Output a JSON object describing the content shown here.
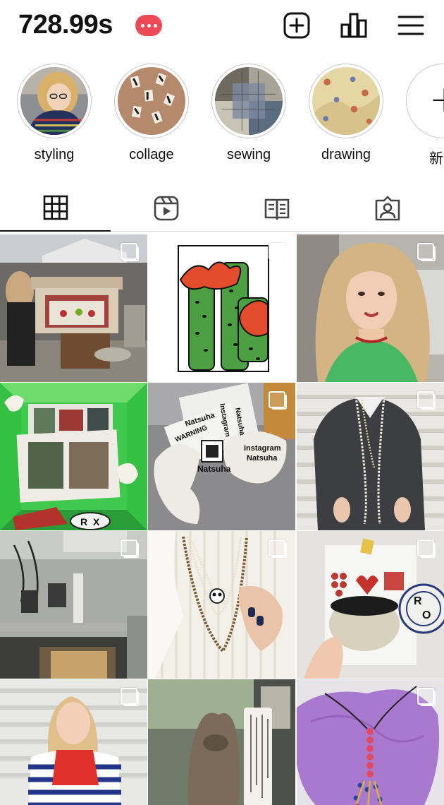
{
  "header": {
    "username": "728.99s",
    "badge": "more",
    "icons": [
      "new-post-icon",
      "insights-icon",
      "menu-icon"
    ]
  },
  "highlights": [
    {
      "label": "styling"
    },
    {
      "label": "collage"
    },
    {
      "label": "sewing"
    },
    {
      "label": "drawing"
    },
    {
      "label": "新規"
    }
  ],
  "tabs": [
    "grid-icon",
    "reels-icon",
    "guides-icon",
    "tagged-icon"
  ],
  "grid": {
    "posts": [
      {
        "subject": "miniature stage street market",
        "multi": true
      },
      {
        "subject": "cactus drawing",
        "multi": true
      },
      {
        "subject": "portrait green top",
        "multi": true
      },
      {
        "subject": "green box collage",
        "multi": false
      },
      {
        "subject": "Natsuha butterfly cutouts",
        "multi": true
      },
      {
        "subject": "pearl necklaces",
        "multi": true
      },
      {
        "subject": "building exterior",
        "multi": true
      },
      {
        "subject": "pearl panda necklace",
        "multi": true
      },
      {
        "subject": "ceramic bowl",
        "multi": true
      },
      {
        "subject": "striped sweater",
        "multi": true
      },
      {
        "subject": "tree sculpture sign",
        "multi": false
      },
      {
        "subject": "beaded tassel on purple",
        "multi": true
      }
    ],
    "cutout_texts": [
      "Natsuha",
      "Instagram",
      "Natsuha",
      "WARNING",
      "Natsuha",
      "Instagram",
      "Natsuha"
    ],
    "sign_texts": [
      "R",
      "X",
      "R",
      "O"
    ]
  }
}
